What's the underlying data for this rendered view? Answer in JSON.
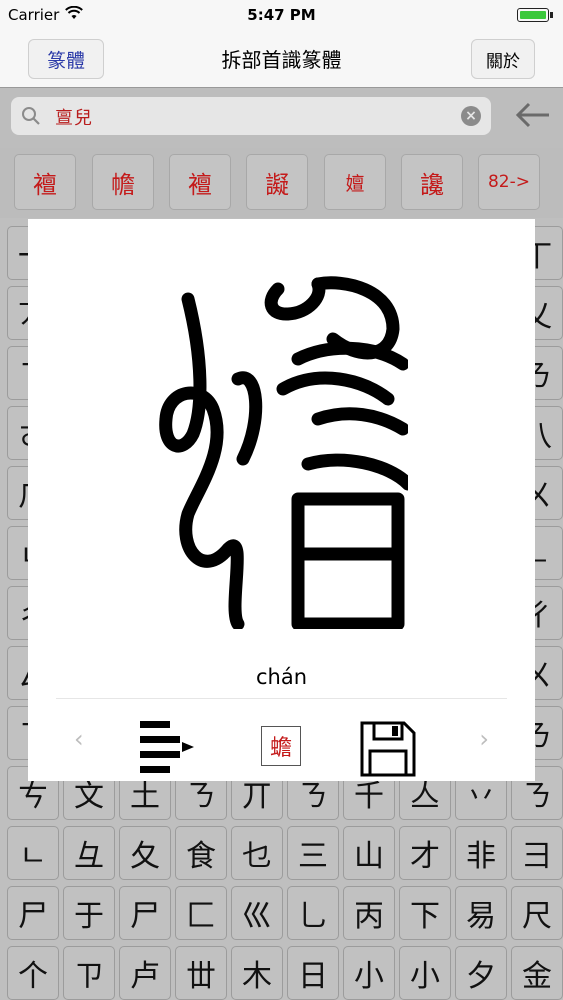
{
  "status": {
    "carrier": "Carrier",
    "time": "5:47 PM"
  },
  "nav": {
    "left_button": "篆體",
    "title": "拆部首識篆體",
    "right_button": "關於"
  },
  "search": {
    "value": "亶兒"
  },
  "results": {
    "items": [
      "襢",
      "幨",
      "襢",
      "譺",
      "嬗",
      "讒"
    ],
    "more": "82->"
  },
  "modal": {
    "pinyin": "chán",
    "mini_char": "蟾",
    "prev": "‹",
    "next": "›"
  },
  "grid": {
    "rows": [
      [
        "一",
        "",
        "",
        "",
        "",
        "",
        "",
        "",
        "",
        "丅"
      ],
      [
        "丆",
        "",
        "",
        "",
        "",
        "",
        "",
        "",
        "",
        "乂"
      ],
      [
        "ㄋ",
        "",
        "",
        "",
        "",
        "",
        "",
        "",
        "",
        "ㄋ"
      ],
      [
        "ㄜ",
        "",
        "",
        "",
        "",
        "",
        "",
        "",
        "",
        "八"
      ],
      [
        "ㄏ",
        "",
        "",
        "",
        "",
        "",
        "",
        "",
        "",
        "ㄨ"
      ],
      [
        "ㄴ",
        "",
        "",
        "",
        "",
        "",
        "",
        "",
        "",
        "ㄴ"
      ],
      [
        "ㄔ",
        "",
        "",
        "",
        "",
        "",
        "",
        "",
        "",
        "ㄔ"
      ],
      [
        "ㄙ",
        "",
        "",
        "",
        "",
        "",
        "",
        "",
        "",
        "ㄨ"
      ],
      [
        "ㄋ",
        "",
        "",
        "",
        "",
        "",
        "",
        "",
        "",
        "ㄋ"
      ],
      [
        "ㄘ",
        "文",
        "土",
        "ㄋ",
        "丌",
        "ㄋ",
        "千",
        "亼",
        "丷",
        "ㄋ"
      ],
      [
        "ㄴ",
        "彑",
        "夂",
        "食",
        "乜",
        "三",
        "山",
        "才",
        "非",
        "彐"
      ],
      [
        "尸",
        "于",
        "尸",
        "匚",
        "巛",
        "乚",
        "丙",
        "下",
        "易",
        "尺"
      ],
      [
        "个",
        "ㄗ",
        "卢",
        "丗",
        "木",
        "日",
        "小",
        "小",
        "夕",
        "金"
      ]
    ]
  }
}
